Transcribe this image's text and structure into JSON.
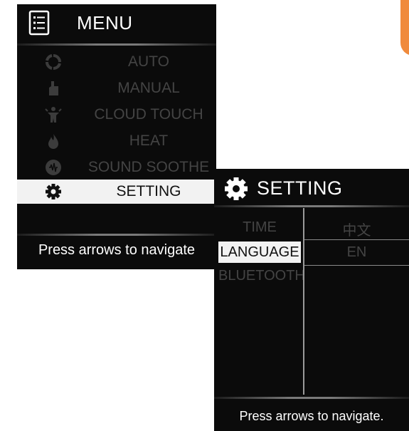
{
  "menu": {
    "title": "MENU",
    "items": [
      {
        "label": "AUTO",
        "icon": "refresh-cycle-icon"
      },
      {
        "label": "MANUAL",
        "icon": "thumbs-up-hand-icon"
      },
      {
        "label": "CLOUD TOUCH",
        "icon": "body-touch-icon"
      },
      {
        "label": "HEAT",
        "icon": "flame-icon"
      },
      {
        "label": "SOUND SOOTHE",
        "icon": "sound-wave-icon"
      },
      {
        "label": "SETTING",
        "icon": "gear-icon"
      }
    ],
    "selected": "SETTING",
    "footer": "Press arrows to navigate"
  },
  "setting": {
    "title": "SETTING",
    "options": [
      {
        "label": "TIME"
      },
      {
        "label": "LANGUAGE"
      },
      {
        "label": "BLUETOOTH"
      }
    ],
    "selected_option": "LANGUAGE",
    "values": [
      {
        "label": "中文"
      },
      {
        "label": "EN"
      }
    ],
    "footer": "Press arrows to navigate."
  },
  "colors": {
    "panel_bg": "#0b0b0b",
    "highlight": "#f2f2f2",
    "inactive_text": "#444444",
    "accent": "#f08a3c"
  }
}
